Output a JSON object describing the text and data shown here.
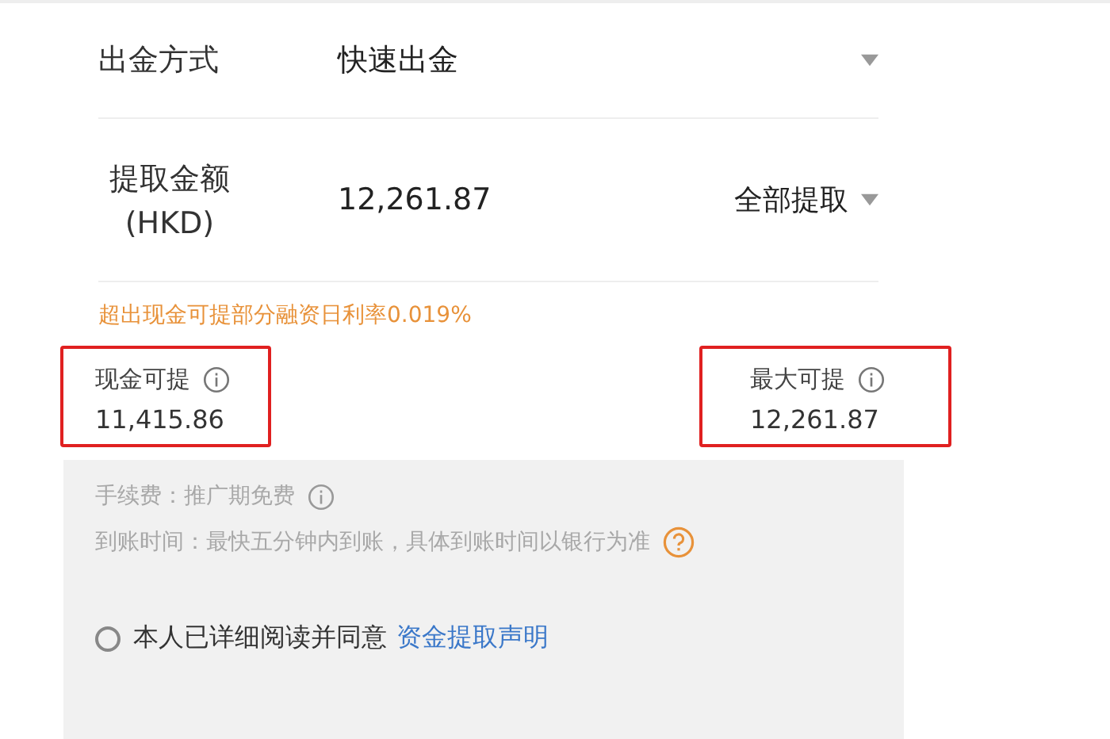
{
  "method_row": {
    "label": "出金方式",
    "value": "快速出金"
  },
  "amount_row": {
    "label": "提取金额",
    "unit": "(HKD)",
    "value": "12,261.87",
    "action": "全部提取"
  },
  "notice": "超出现金可提部分融资日利率0.019%",
  "stats": [
    {
      "label": "现金可提",
      "value": "11,415.86",
      "highlighted": true
    },
    {
      "label": "最大可提",
      "value": "12,261.87",
      "highlighted": true
    }
  ],
  "info": {
    "fee": "手续费：推广期免费",
    "arrival": "到账时间：最快五分钟内到账，具体到账时间以银行为准"
  },
  "agreement": {
    "checked": false,
    "text": "本人已详细阅读并同意",
    "link": "资金提取声明"
  }
}
